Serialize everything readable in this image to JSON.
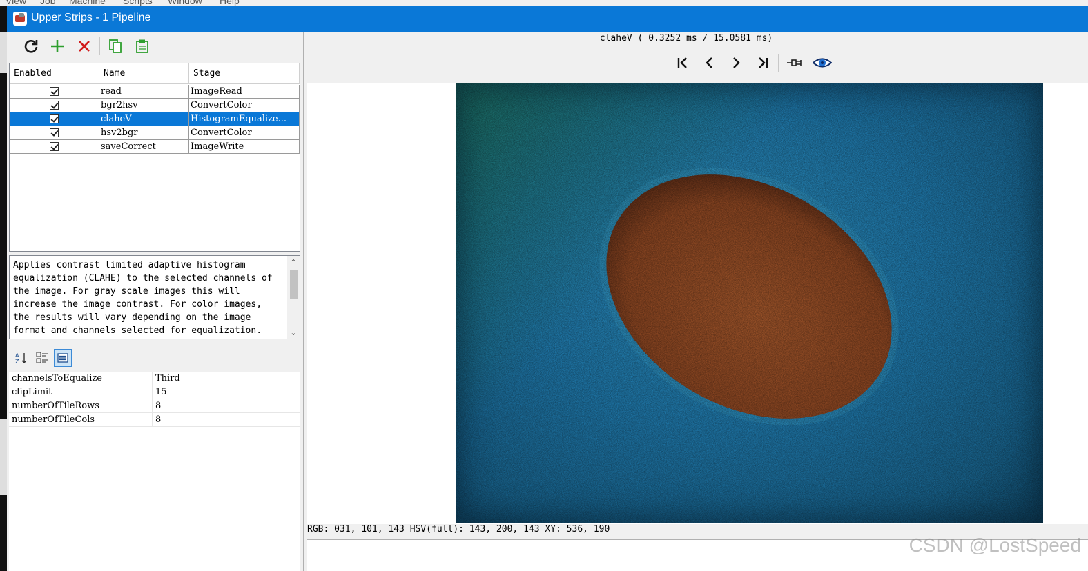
{
  "background_menu": [
    "View",
    "Job",
    "Machine",
    "Scripts",
    "Window",
    "Help"
  ],
  "window": {
    "title": "Upper Strips - 1 Pipeline"
  },
  "toolbar": {
    "buttons": [
      {
        "name": "refresh-icon",
        "color": "#1a1a1a"
      },
      {
        "name": "add-icon",
        "color": "#2e9e2e"
      },
      {
        "name": "delete-icon",
        "color": "#d11a1a"
      },
      {
        "name": "copy-icon",
        "color": "#2e9e2e"
      },
      {
        "name": "paste-icon",
        "color": "#2e9e2e"
      }
    ]
  },
  "pipeline_table": {
    "headers": [
      "Enabled",
      "Name",
      "Stage"
    ],
    "rows": [
      {
        "enabled": true,
        "name": "read",
        "stage": "ImageRead"
      },
      {
        "enabled": true,
        "name": "bgr2hsv",
        "stage": "ConvertColor"
      },
      {
        "enabled": true,
        "name": "claheV",
        "stage": "HistogramEqualize...",
        "selected": true
      },
      {
        "enabled": true,
        "name": "hsv2bgr",
        "stage": "ConvertColor"
      },
      {
        "enabled": true,
        "name": "saveCorrect",
        "stage": "ImageWrite"
      }
    ]
  },
  "description": "Applies contrast limited adaptive histogram equalization (CLAHE) to the selected channels of the image. For gray scale images this will increase the image contrast. For color images, the results will vary depending on the image format and channels selected for equalization.",
  "property_toolbar": [
    "sort-alpha-icon",
    "categorized-icon",
    "property-pages-icon"
  ],
  "properties": [
    {
      "key": "channelsToEqualize",
      "value": "Third"
    },
    {
      "key": "clipLimit",
      "value": "15"
    },
    {
      "key": "numberOfTileRows",
      "value": "8"
    },
    {
      "key": "numberOfTileCols",
      "value": "8"
    }
  ],
  "viewer": {
    "timing": "claheV ( 0.3252 ms / 15.0581 ms)",
    "nav": [
      "first-icon",
      "previous-icon",
      "next-icon",
      "last-icon",
      "pin-icon",
      "eye-icon"
    ],
    "status": "RGB: 031, 101, 143 HSV(full): 143, 200, 143 XY: 536, 190",
    "colors": {
      "background": "#2285bd",
      "ellipse": "#a5542a",
      "accent": "#0a78d7"
    }
  },
  "watermark": "CSDN @LostSpeed"
}
